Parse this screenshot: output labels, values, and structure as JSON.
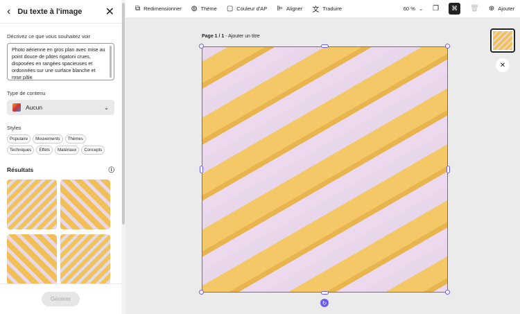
{
  "panel": {
    "title": "Du texte à l'image",
    "prompt_label": "Décrivez ce que vous souhaitez voir",
    "prompt": "Photo aérienne en gros plan avec mise au point douce de pâtes rigatoni crues, disposées en rangées spacieuses et ordonnées sur une surface blanche et rose pâle",
    "content_type_label": "Type de contenu",
    "content_type": "Aucun",
    "styles_label": "Styles",
    "styles": [
      "Populaire",
      "Mouvements",
      "Thèmes",
      "Techniques",
      "Effets",
      "Matériaux",
      "Concepts"
    ],
    "results_label": "Résultats",
    "generate": "Générer"
  },
  "toolbar": {
    "resize": "Redimensionner",
    "theme": "Thème",
    "color": "Couleur d'AP",
    "align": "Aligner",
    "translate": "Traduire",
    "zoom": "60 %",
    "add": "Ajouter"
  },
  "canvas": {
    "page": "Page 1 / 1",
    "title": " - Ajouter un titre"
  }
}
